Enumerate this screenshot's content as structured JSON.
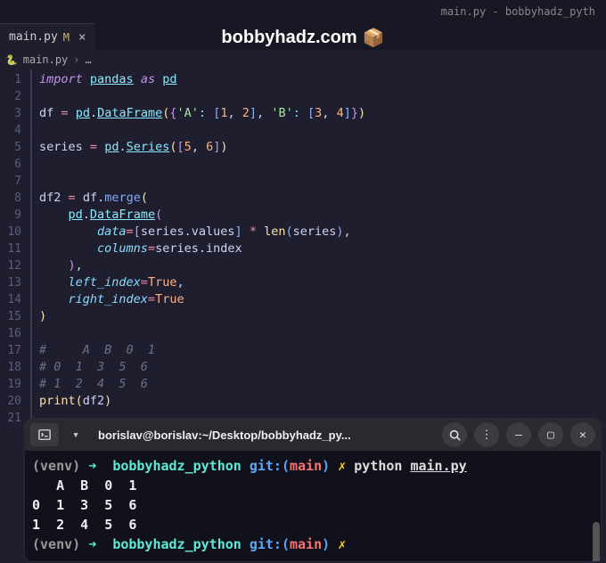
{
  "window": {
    "title": "main.py - bobbyhadz_pyth"
  },
  "tab": {
    "filename": "main.py",
    "modified_flag": "M"
  },
  "overlay": {
    "text": "bobbyhadz.com",
    "icon": "📦"
  },
  "breadcrumb": {
    "file": "main.py",
    "sep": "›",
    "more": "…"
  },
  "lines": [
    "1",
    "2",
    "3",
    "4",
    "5",
    "6",
    "7",
    "8",
    "9",
    "10",
    "11",
    "12",
    "13",
    "14",
    "15",
    "16",
    "17",
    "18",
    "19",
    "20",
    "21"
  ],
  "code": {
    "l1": {
      "import": "import",
      "pandas": "pandas",
      "as": "as",
      "pd": "pd"
    },
    "l3": {
      "df": "df",
      "eq": "=",
      "pd": "pd",
      "dot": ".",
      "DataFrame": "DataFrame",
      "open": "(",
      "brace_o": "{",
      "strA": "'A'",
      "colon1": ":",
      "brk1o": "[",
      "n1": "1",
      "comma1": ",",
      "n2": "2",
      "brk1c": "]",
      "comma2": ",",
      "strB": "'B'",
      "colon2": ":",
      "brk2o": "[",
      "n3": "3",
      "comma3": ",",
      "n4": "4",
      "brk2c": "]",
      "brace_c": "}",
      "close": ")"
    },
    "l5": {
      "series": "series",
      "eq": "=",
      "pd": "pd",
      "dot": ".",
      "Series": "Series",
      "open": "(",
      "brko": "[",
      "n5": "5",
      "comma": ",",
      "n6": "6",
      "brkc": "]",
      "close": ")"
    },
    "l8": {
      "df2": "df2",
      "eq": "=",
      "df": "df",
      "dot": ".",
      "merge": "merge",
      "open": "("
    },
    "l9": {
      "pd": "pd",
      "dot": ".",
      "DataFrame": "DataFrame",
      "open": "("
    },
    "l10": {
      "data": "data",
      "eq": "=",
      "brko": "[",
      "series": "series",
      "dot": ".",
      "values": "values",
      "brkc": "]",
      "star": "*",
      "len": "len",
      "open": "(",
      "series2": "series",
      "close": ")",
      "comma": ","
    },
    "l11": {
      "columns": "columns",
      "eq": "=",
      "series": "series",
      "dot": ".",
      "index": "index"
    },
    "l12": {
      "close": ")",
      "comma": ","
    },
    "l13": {
      "left_index": "left_index",
      "eq": "=",
      "True": "True",
      "comma": ","
    },
    "l14": {
      "right_index": "right_index",
      "eq": "=",
      "True": "True"
    },
    "l15": {
      "close": ")"
    },
    "l17": "#     A  B  0  1",
    "l18": "# 0  1  3  5  6",
    "l19": "# 1  2  4  5  6",
    "l20": {
      "print": "print",
      "open": "(",
      "df2": "df2",
      "close": ")"
    }
  },
  "terminal": {
    "title": "borislav@borislav:~/Desktop/bobbyhadz_py...",
    "prompt": {
      "venv": "(venv)",
      "arrow": "➜",
      "dir": "bobbyhadz_python",
      "git": "git:(",
      "branch": "main",
      "gitclose": ")",
      "x": "✗"
    },
    "cmd": {
      "python": "python",
      "file": "main.py"
    },
    "output": {
      "r0": "   A  B  0  1",
      "r1": "0  1  3  5  6",
      "r2": "1  2  4  5  6"
    }
  }
}
